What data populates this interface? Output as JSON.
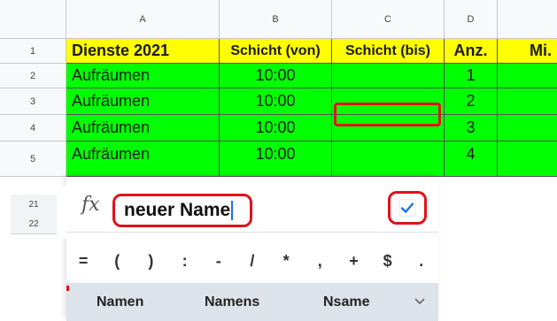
{
  "sheet": {
    "columns": [
      "A",
      "B",
      "C",
      "D"
    ],
    "rows": [
      {
        "num": "1",
        "cells": [
          "Dienste 2021",
          "Schicht (von)",
          "Schicht (bis)",
          "Anz.",
          "Mi."
        ]
      },
      {
        "num": "2",
        "cells": [
          "Aufräumen",
          "10:00",
          "",
          "1",
          ""
        ]
      },
      {
        "num": "3",
        "cells": [
          "Aufräumen",
          "10:00",
          "",
          "2",
          ""
        ]
      },
      {
        "num": "4",
        "cells": [
          "Aufräumen",
          "10:00",
          "",
          "3",
          ""
        ]
      },
      {
        "num": "5",
        "cells": [
          "Aufräumen",
          "10:00",
          "",
          "4",
          ""
        ]
      }
    ],
    "hidden_rows": [
      "21",
      "22"
    ]
  },
  "editor": {
    "fx_label": "fx",
    "input_value": "neuer Name",
    "confirm_icon": "check-icon"
  },
  "symbols": [
    "=",
    "(",
    ")",
    ":",
    "-",
    "/",
    "*",
    ",",
    "+",
    "$",
    "."
  ],
  "suggestions": [
    "Namen",
    "Namens",
    "Nsame"
  ],
  "colors": {
    "header_fill": "#ffff00",
    "data_fill": "#00ff00",
    "highlight": "#e0121c",
    "accent": "#1a73e8"
  }
}
